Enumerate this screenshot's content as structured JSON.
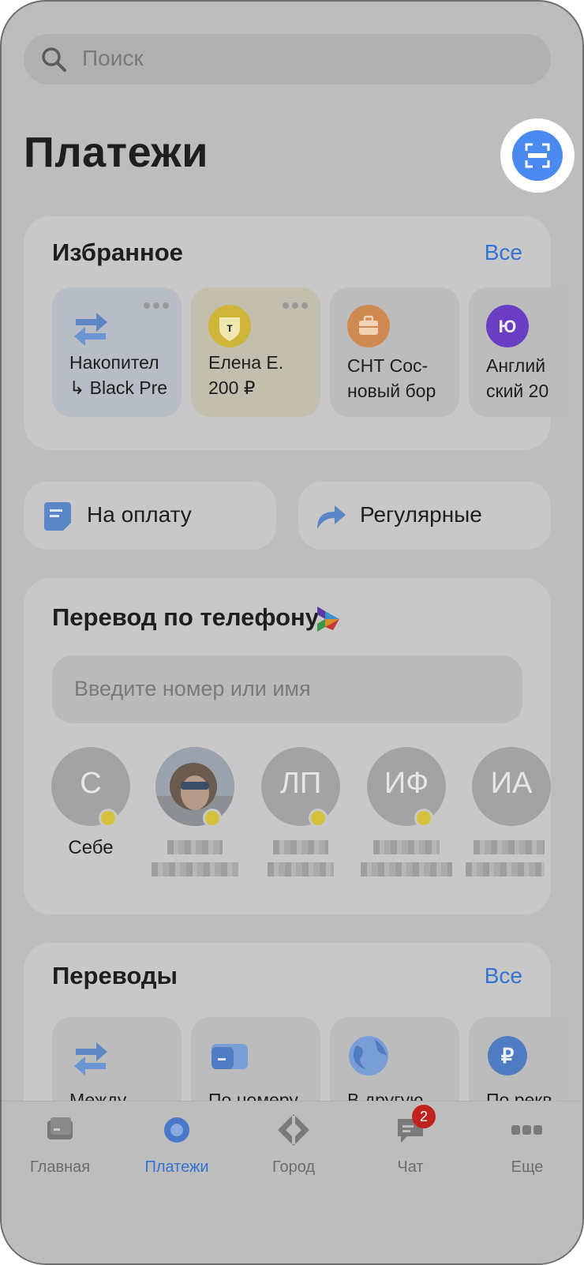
{
  "search": {
    "placeholder": "Поиск"
  },
  "page_title": "Платежи",
  "favorites": {
    "title": "Избранное",
    "all_label": "Все",
    "items": [
      {
        "line1": "Накопител",
        "line2": "↳ Black Pre",
        "icon": "transfer-arrows-icon"
      },
      {
        "line1": "Елена Е.",
        "line2": "200 ₽",
        "icon": "tinkoff-logo-icon"
      },
      {
        "line1": "СНТ Сос-",
        "line2": "новый бор",
        "icon": "briefcase-icon"
      },
      {
        "line1": "Англий",
        "line2": "ский 20",
        "icon": "yumoney-logo-icon"
      }
    ]
  },
  "quick": {
    "to_pay": "На оплату",
    "regular": "Регулярные"
  },
  "phone_transfer": {
    "title": "Перевод по телефону",
    "input_placeholder": "Введите номер или имя",
    "contacts": [
      {
        "initials": "С",
        "name": "Себе"
      },
      {
        "initials": "",
        "name": ""
      },
      {
        "initials": "ЛП",
        "name": ""
      },
      {
        "initials": "ИФ",
        "name": ""
      },
      {
        "initials": "ИА",
        "name": ""
      }
    ]
  },
  "transfers": {
    "title": "Переводы",
    "all_label": "Все",
    "items": [
      {
        "label": "Между"
      },
      {
        "label": "По номеру"
      },
      {
        "label": "В другую"
      },
      {
        "label": "По рекв"
      }
    ]
  },
  "tabbar": {
    "items": [
      {
        "label": "Главная"
      },
      {
        "label": "Платежи"
      },
      {
        "label": "Город"
      },
      {
        "label": "Чат",
        "badge": "2"
      },
      {
        "label": "Еще"
      }
    ]
  },
  "colors": {
    "accent": "#3573d3",
    "badge": "#c0221e",
    "scan": "#4a8af0"
  }
}
